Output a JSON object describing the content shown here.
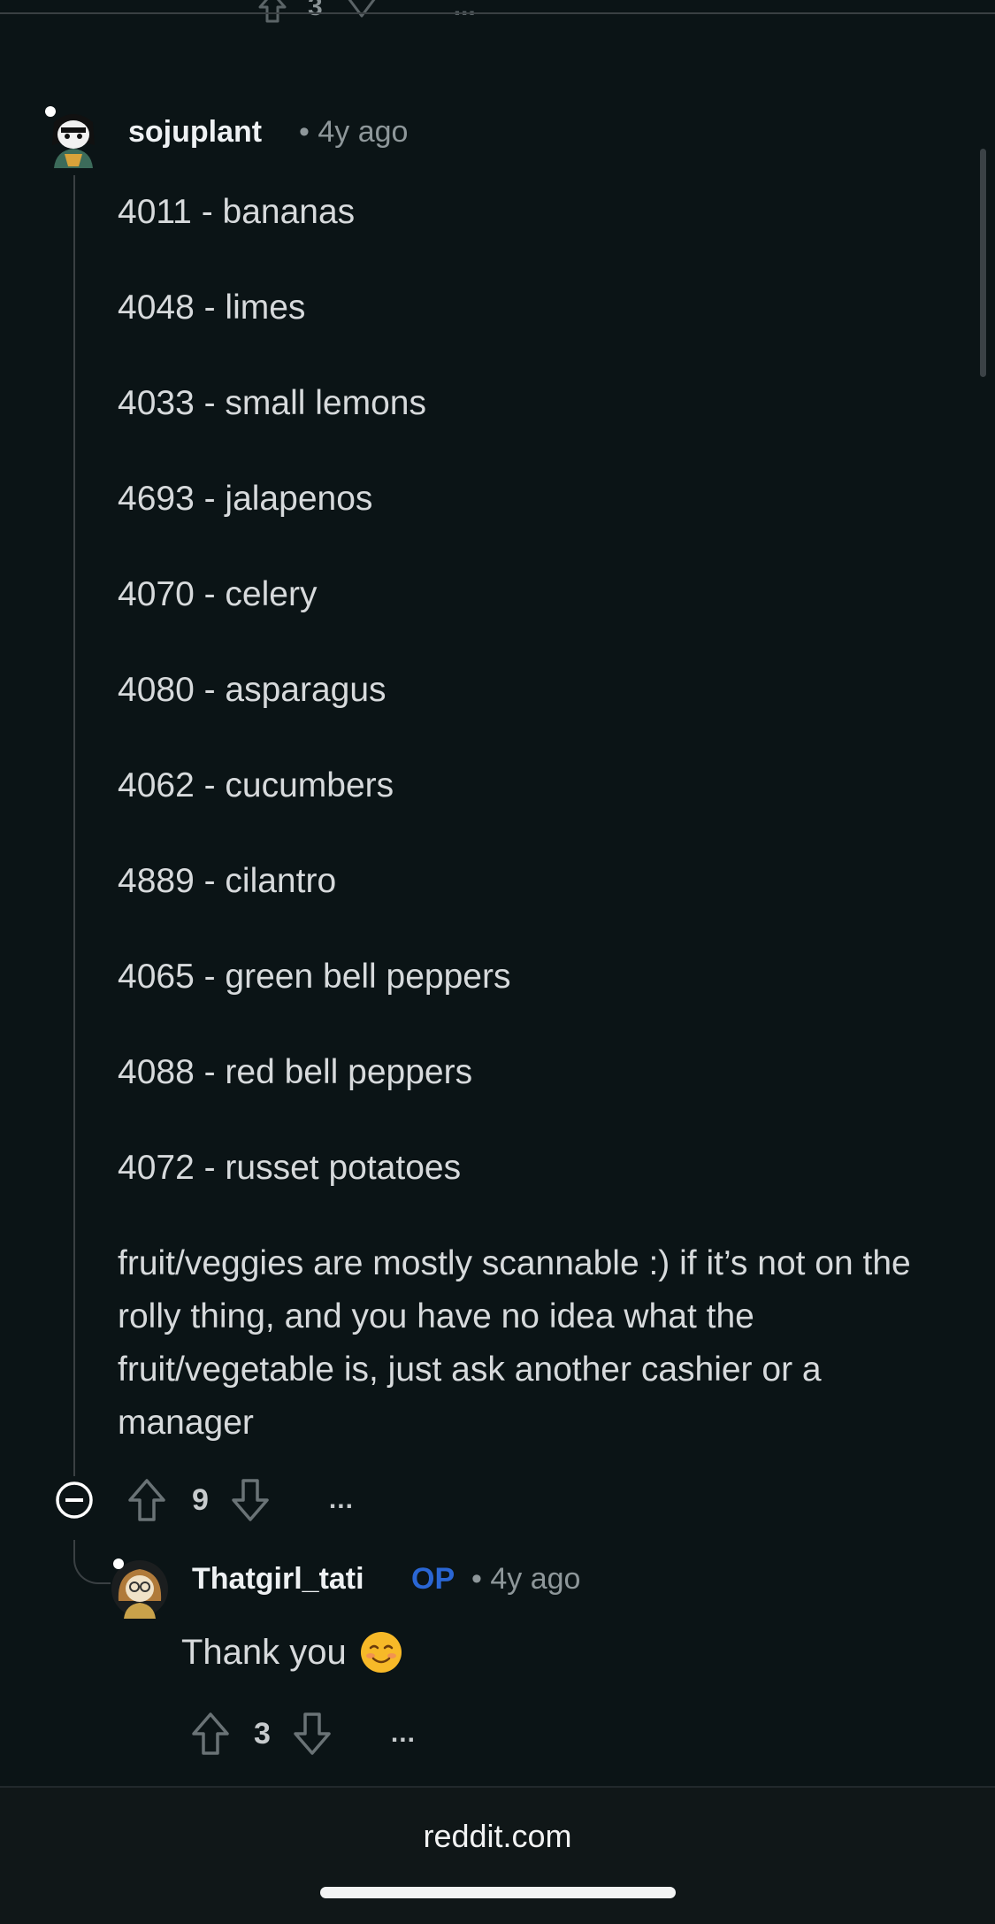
{
  "previous": {
    "vote_count": "3",
    "more": "..."
  },
  "comment": {
    "username": "sojuplant",
    "meta": "• 4y ago",
    "lines": [
      "4011 - bananas",
      "4048 - limes",
      "4033 - small lemons",
      "4693 - jalapenos",
      "4070 - celery",
      "4080 - asparagus",
      "4062 - cucumbers",
      "4889 - cilantro",
      "4065 - green bell peppers",
      "4088 - red bell peppers",
      "4072 - russet potatoes"
    ],
    "paragraph": "fruit/veggies are mostly scannable :) if it’s not on the rolly thing, and you have no idea what the fruit/vegetable is, just ask another cashier or a manager",
    "vote_count": "9",
    "more": "..."
  },
  "reply": {
    "username": "Thatgirl_tati",
    "op_badge": "OP",
    "meta": "• 4y ago",
    "body": "Thank you",
    "emoji": "☺️",
    "vote_count": "3",
    "more": "..."
  },
  "footer": {
    "domain": "reddit.com"
  },
  "colors": {
    "background": "#0b1416",
    "op_badge": "#2a66d4",
    "text": "#d7dadc"
  }
}
